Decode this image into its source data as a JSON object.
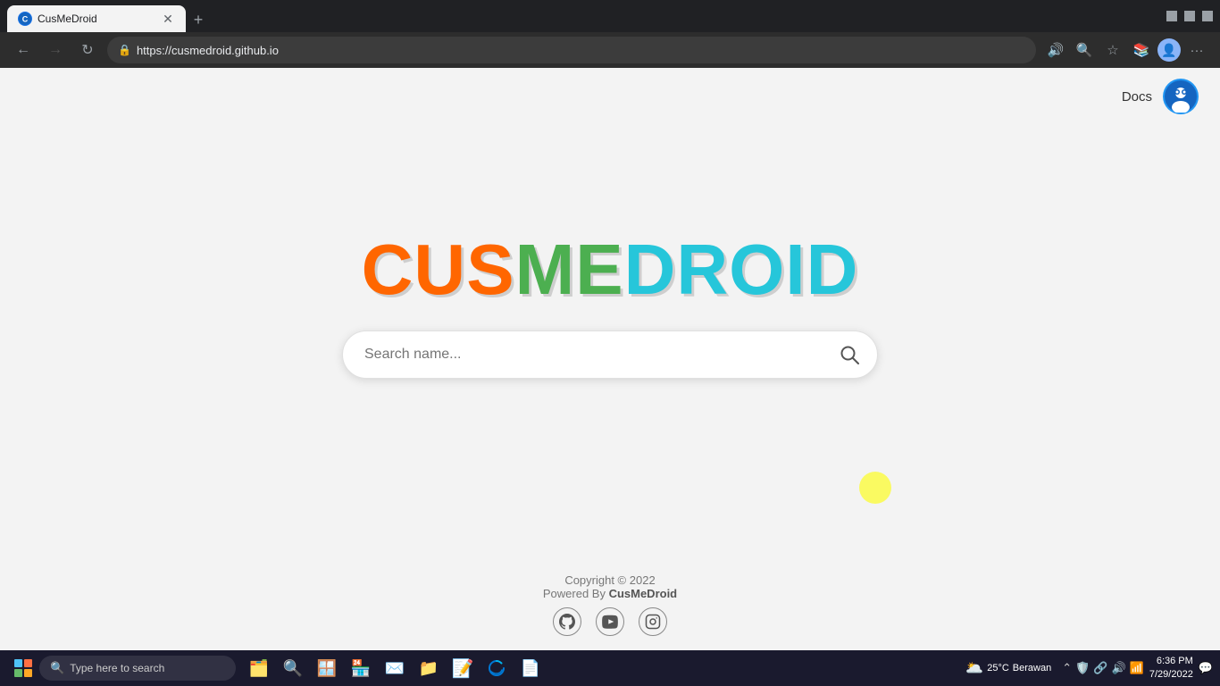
{
  "browser": {
    "tab_title": "CusMeDroid",
    "tab_favicon": "C",
    "url": "https://cusmedroid.github.io",
    "url_display": "https://cusmedroid.github.io"
  },
  "site": {
    "nav": {
      "docs_label": "Docs"
    },
    "logo": {
      "cus": "CUS",
      "me": "ME",
      "droid": "DROID"
    },
    "search": {
      "placeholder": "Search name..."
    },
    "footer": {
      "copyright": "Copyright © 2022",
      "powered_by": "Powered By ",
      "brand": "CusMeDroid"
    },
    "social": {
      "github_label": "GitHub",
      "youtube_label": "YouTube",
      "instagram_label": "Instagram"
    }
  },
  "taskbar": {
    "search_placeholder": "Type here to search",
    "datetime": {
      "time": "6:36 PM",
      "date": "7/29/2022"
    },
    "weather": {
      "temp": "25°C",
      "condition": "Berawan"
    }
  }
}
